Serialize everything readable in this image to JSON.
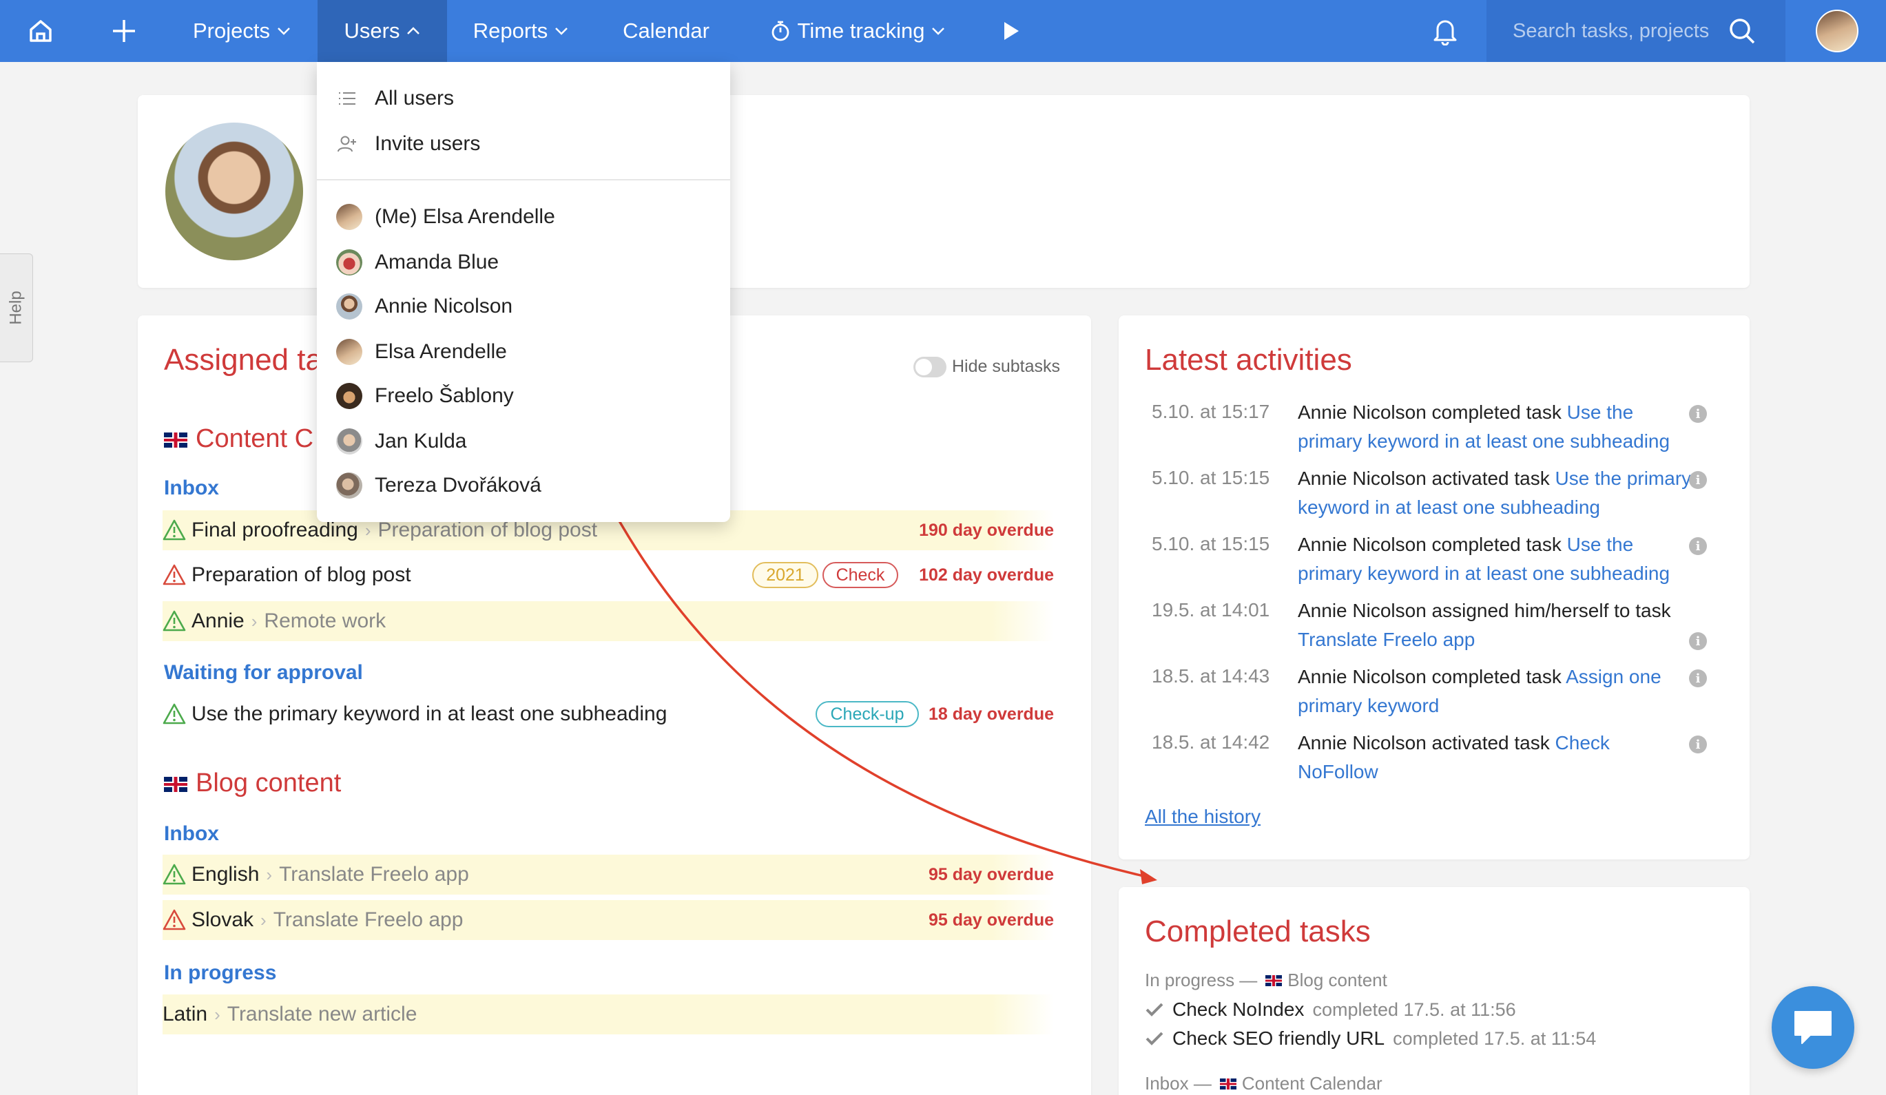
{
  "nav": {
    "projects": "Projects",
    "users": "Users",
    "reports": "Reports",
    "calendar": "Calendar",
    "time_tracking": "Time tracking",
    "search_placeholder": "Search tasks, projects"
  },
  "help_label": "Help",
  "users_menu": {
    "all_users": "All users",
    "invite_users": "Invite users",
    "users": [
      "(Me) Elsa Arendelle",
      "Amanda Blue",
      "Annie Nicolson",
      "Elsa Arendelle",
      "Freelo Šablony",
      "Jan Kulda",
      "Tereza Dvořáková"
    ]
  },
  "assigned": {
    "title": "Assigned ta",
    "hide_subtasks": "Hide subtasks",
    "project1": "Content C",
    "p1_list1": "Inbox",
    "p1_tasks": [
      {
        "name": "Final proofreading",
        "parent": "Preparation of blog post",
        "overdue": "190 day overdue"
      },
      {
        "name": "Preparation of blog post",
        "tag1": "2021",
        "tag2": "Check",
        "overdue": "102 day overdue"
      },
      {
        "name": "Annie",
        "parent": "Remote work"
      }
    ],
    "p1_list2": "Waiting for approval",
    "p1_task4": {
      "name": "Use the primary keyword in at least one subheading",
      "tag": "Check-up",
      "overdue": "18 day overdue"
    },
    "project2": "Blog content",
    "p2_list1": "Inbox",
    "p2_tasks": [
      {
        "name": "English",
        "parent": "Translate Freelo app",
        "overdue": "95 day overdue"
      },
      {
        "name": "Slovak",
        "parent": "Translate Freelo app",
        "overdue": "95 day overdue"
      }
    ],
    "p2_list2": "In progress",
    "p2_task3": {
      "name": "Latin",
      "parent": "Translate new article"
    }
  },
  "activities": {
    "title": "Latest activities",
    "items": [
      {
        "time": "5.10. at 15:17",
        "text": "Annie Nicolson completed task ",
        "link": "Use the primary keyword in at least one subheading"
      },
      {
        "time": "5.10. at 15:15",
        "text": "Annie Nicolson activated task ",
        "link": "Use the primary keyword in at least one subheading"
      },
      {
        "time": "5.10. at 15:15",
        "text": "Annie Nicolson completed task ",
        "link": "Use the primary keyword in at least one subheading"
      },
      {
        "time": "19.5. at 14:01",
        "text": "Annie Nicolson assigned him/herself to task ",
        "link": "Translate Freelo app"
      },
      {
        "time": "18.5. at 14:43",
        "text": "Annie Nicolson completed task ",
        "link": "Assign one primary keyword"
      },
      {
        "time": "18.5. at 14:42",
        "text": "Annie Nicolson activated task ",
        "link": "Check NoFollow"
      }
    ],
    "history": "All the history"
  },
  "completed": {
    "title": "Completed tasks",
    "group1_list": "In progress —",
    "group1_project": "Blog content",
    "items": [
      {
        "name": "Check NoIndex",
        "meta": "completed 17.5. at 11:56"
      },
      {
        "name": "Check SEO friendly URL",
        "meta": "completed 17.5. at 11:54"
      }
    ],
    "group2_list": "Inbox —",
    "group2_project": "Content Calendar"
  },
  "colors": {
    "topbar": "#3b7ddd",
    "accent_red": "#cf3a3a",
    "link_blue": "#3477d1",
    "tag_gold": "#d9a82e",
    "tag_teal": "#2aa7b7"
  }
}
